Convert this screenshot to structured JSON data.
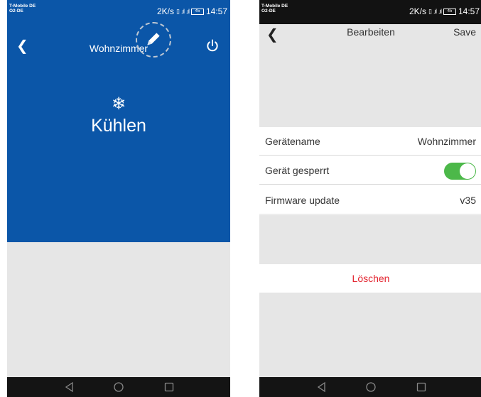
{
  "status": {
    "carrier_line1": "T-Mobile DE",
    "carrier_line2": "O2-DE",
    "speed": "2K/s",
    "network_4g": "4G",
    "battery": "45",
    "time": "14:57"
  },
  "left_screen": {
    "header": {
      "title": "Wohnzimmer"
    },
    "mode": {
      "label": "Kühlen",
      "icon": "❄"
    },
    "icons": [
      "back-icon",
      "pencil-icon",
      "power-icon",
      "snowflake-icon"
    ]
  },
  "right_screen": {
    "header": {
      "title": "Bearbeiten",
      "save_label": "Save"
    },
    "rows": [
      {
        "label": "Gerätename",
        "value": "Wohnzimmer"
      },
      {
        "label": "Gerät gesperrt",
        "toggle_on": true
      },
      {
        "label": "Firmware update",
        "value": "v35"
      }
    ],
    "delete_label": "Löschen"
  },
  "colors": {
    "primary_blue": "#0b56a8",
    "toggle_green": "#4cb849",
    "delete_red": "#e32530",
    "background_grey": "#e6e6e6"
  }
}
